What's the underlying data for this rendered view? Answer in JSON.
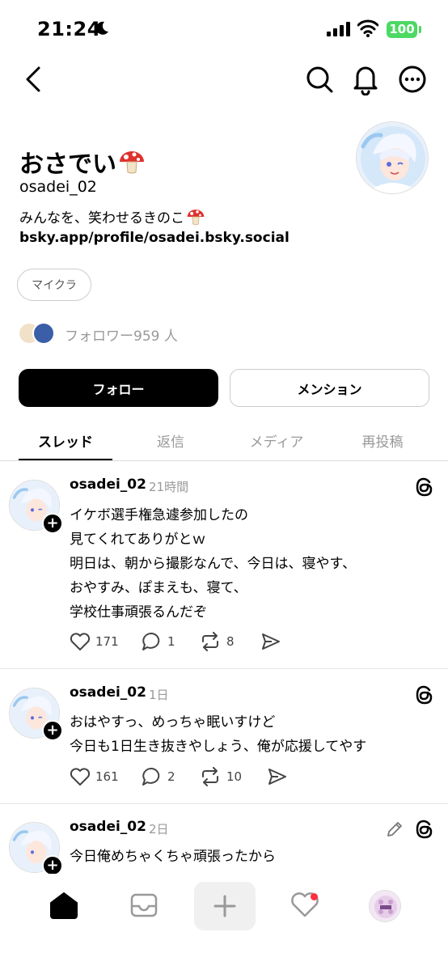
{
  "status_bar": {
    "time": "21:24",
    "battery": "100"
  },
  "profile": {
    "name": "おさでい",
    "name_emoji": "mushroom-icon",
    "handle": "osadei_02",
    "bio": "みんなを、笑わせるきのこ",
    "bio_emoji": "mushroom-icon",
    "link": "bsky.app/profile/osadei.bsky.social",
    "tag": "マイクラ",
    "followers": "フォロワー959 人"
  },
  "buttons": {
    "follow": "フォロー",
    "mention": "メンション"
  },
  "tabs": [
    {
      "label": "スレッド",
      "active": true
    },
    {
      "label": "返信",
      "active": false
    },
    {
      "label": "メディア",
      "active": false
    },
    {
      "label": "再投稿",
      "active": false
    }
  ],
  "posts": [
    {
      "author": "osadei_02",
      "time": "21時間",
      "lines": [
        "イケボ選手権急遽参加したの",
        "見てくれてありがとｗ",
        "明日は、朝から撮影なんで、今日は、寝やす、",
        "おやすみ、ぽまえも、寝て、",
        "学校仕事頑張るんだぞ"
      ],
      "likes": "171",
      "replies": "1",
      "reposts": "8"
    },
    {
      "author": "osadei_02",
      "time": "1日",
      "lines": [
        "おはやすっ、めっちゃ眠いすけど",
        "今日も1日生き抜きやしょう、俺が応援してやす"
      ],
      "likes": "161",
      "replies": "2",
      "reposts": "10"
    },
    {
      "author": "osadei_02",
      "time": "2日",
      "lines": [
        "今日俺めちゃくちゃ頑張ったから"
      ]
    }
  ],
  "colors": {
    "accent": "#000000",
    "muted": "#999999",
    "battery": "#4cd964",
    "notification": "#ff3040"
  }
}
